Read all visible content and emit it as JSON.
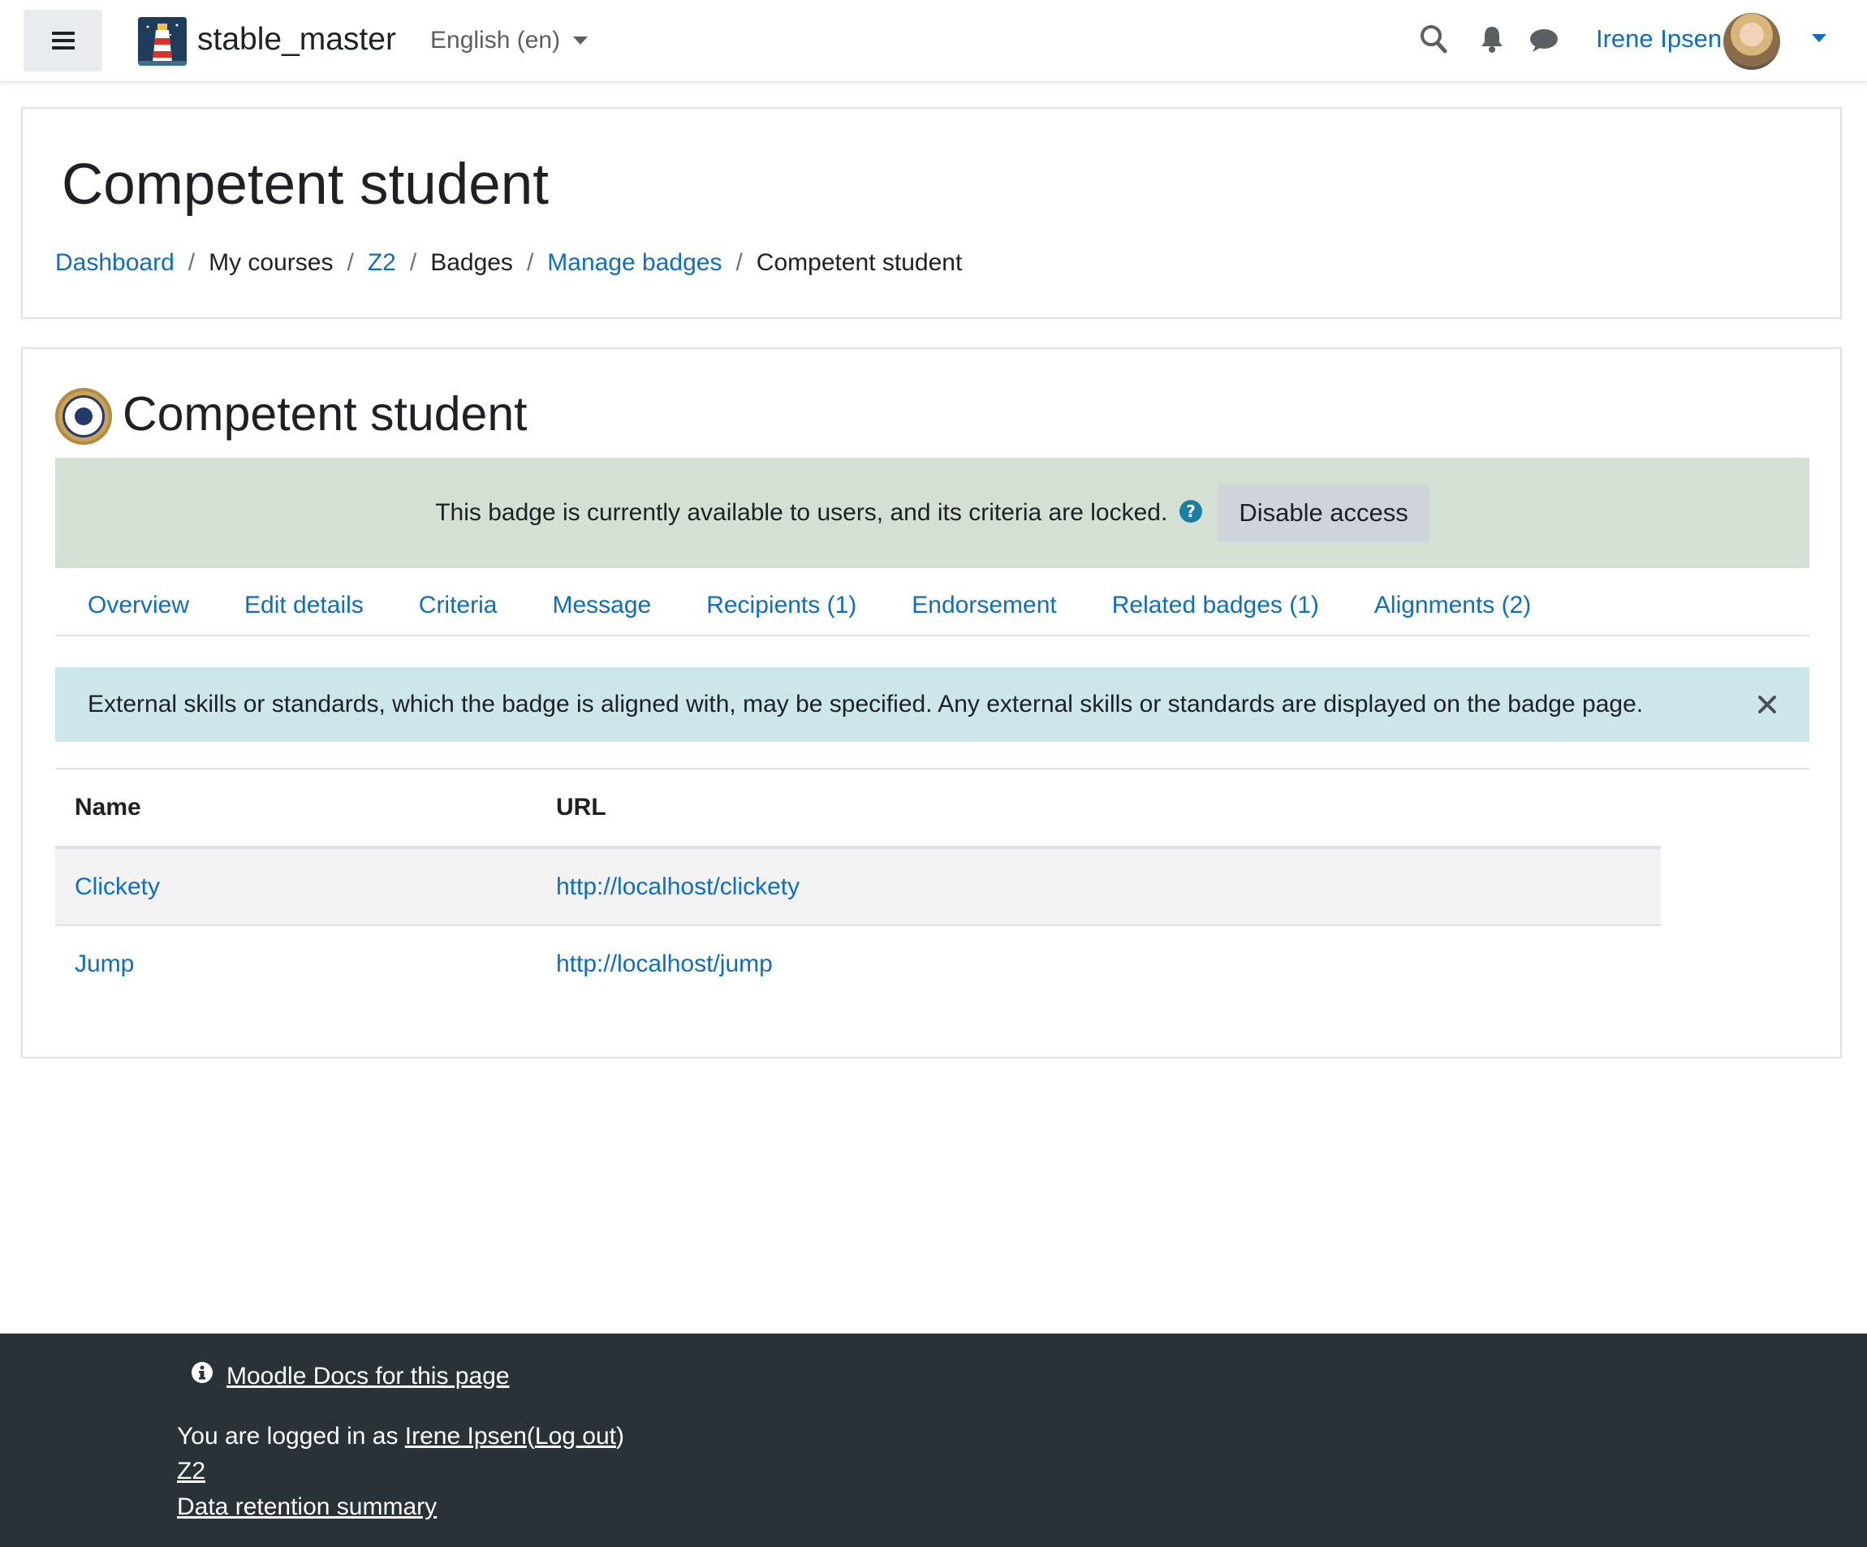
{
  "navbar": {
    "site_name": "stable_master",
    "language": "English (en)",
    "user_name": "Irene Ipsen",
    "icons": [
      "menu-icon",
      "search-icon",
      "bell-icon",
      "chat-icon",
      "chevron-down-icon"
    ]
  },
  "header": {
    "title": "Competent student",
    "breadcrumb": [
      {
        "label": "Dashboard",
        "link": true
      },
      {
        "label": "My courses",
        "link": false
      },
      {
        "label": "Z2",
        "link": true
      },
      {
        "label": "Badges",
        "link": false
      },
      {
        "label": "Manage badges",
        "link": true
      },
      {
        "label": "Competent student",
        "link": false
      }
    ]
  },
  "badge": {
    "name": "Competent student",
    "status_message": "This badge is currently available to users, and its criteria are locked.",
    "disable_label": "Disable access"
  },
  "tabs": [
    {
      "label": "Overview"
    },
    {
      "label": "Edit details"
    },
    {
      "label": "Criteria"
    },
    {
      "label": "Message"
    },
    {
      "label": "Recipients (1)"
    },
    {
      "label": "Endorsement"
    },
    {
      "label": "Related badges (1)"
    },
    {
      "label": "Alignments (2)"
    }
  ],
  "info": {
    "message": "External skills or standards, which the badge is aligned with, may be specified. Any external skills or standards are displayed on the badge page."
  },
  "table": {
    "headers": {
      "name": "Name",
      "url": "URL"
    },
    "rows": [
      {
        "name": "Clickety",
        "url": "http://localhost/clickety"
      },
      {
        "name": "Jump",
        "url": "http://localhost/jump"
      }
    ]
  },
  "footer": {
    "docs_link": "Moodle Docs for this page",
    "logged_in_prefix": "You are logged in as ",
    "user_name": "Irene Ipsen",
    "open_paren": "(",
    "logout": "Log out",
    "close_paren": ")",
    "course": "Z2",
    "data_retention": "Data retention summary"
  },
  "colors": {
    "link": "#0f6cbf",
    "status_bg": "#d3e0d3",
    "info_bg": "#cce6ea",
    "footer_bg": "#2a3137"
  }
}
